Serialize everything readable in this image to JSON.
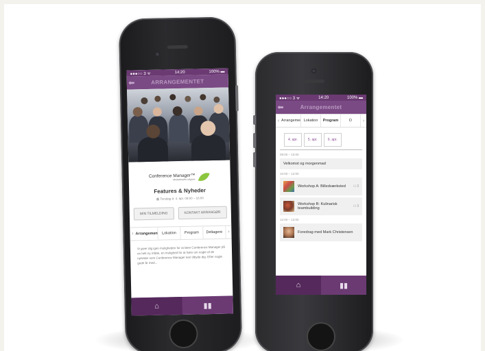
{
  "colors": {
    "primary": "#7a4a84",
    "primary_dark": "#55295c",
    "background": "#f3f2ed"
  },
  "left_phone": {
    "status": {
      "carrier": "●●●○○ 3 ᯤ",
      "time": "14:20",
      "battery": "100% ▬"
    },
    "nav_title": "ARRANGEMENTET",
    "logo": {
      "name": "Conference Manager™",
      "tagline": "Medarbejder-udgave"
    },
    "event_title": "Features & Nyheder",
    "event_date": "Torsdag d. 4. apr. 09:00 – 16:00",
    "buttons": {
      "signup": "MIN TILMELDING",
      "contact": "KONTAKT ARRANGØR"
    },
    "tabs": [
      "Arrangementet",
      "Lokation",
      "Program",
      "Deltagere"
    ],
    "description": "Vi giver dig igen muligheden for at lære Conference Manager på en helt ny måde, en mulighed for at høre om nogle af de nyheder som Conference Manager kan tilbyde dig. Efter nogle gode år med..."
  },
  "right_phone": {
    "status": {
      "carrier": "●●●○○ 3 ᯤ",
      "time": "14:20",
      "battery": "100% ▬"
    },
    "nav_title": "Arrangementet",
    "tabs": [
      "Arrangementet",
      "Lokation",
      "Program",
      "D"
    ],
    "days": [
      "4. apr.",
      "5. apr.",
      "6. apr."
    ],
    "schedule": [
      {
        "time": "09:00 – 10:00",
        "items": [
          {
            "title": "Velkomst og morgenmad",
            "count": "",
            "thumb": ""
          }
        ]
      },
      {
        "time": "10:00 – 12:00",
        "items": [
          {
            "title": "Workshop A: Billedværksted",
            "count": "3",
            "thumb": "workshop-a"
          },
          {
            "title": "Workshop B: Kulinarisk teambuilding",
            "count": "3",
            "thumb": "workshop-b"
          }
        ]
      },
      {
        "time": "12:00 – 13:00",
        "items": [
          {
            "title": "Foredrag med Mark Christensen",
            "count": "",
            "thumb": "speaker"
          }
        ]
      }
    ]
  },
  "icons": {
    "home": "home-icon",
    "stats": "bar-chart-icon",
    "back": "back-arrow-icon",
    "calendar": "calendar-icon"
  }
}
